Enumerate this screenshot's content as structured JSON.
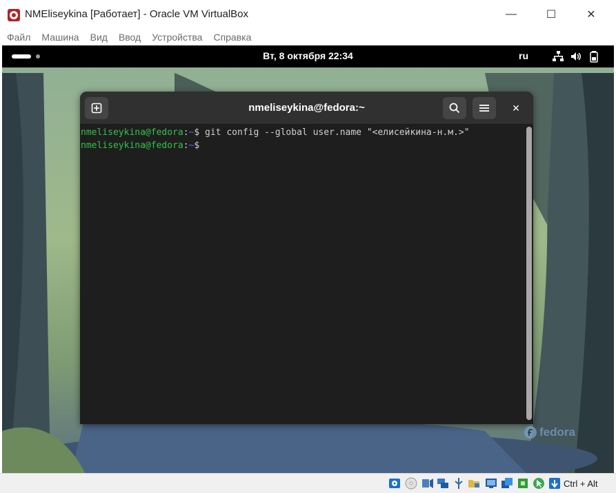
{
  "window": {
    "title": "NMEliseykina [Работает] - Oracle VM VirtualBox",
    "controls": {
      "minimize": "—",
      "maximize": "☐",
      "close": "✕"
    }
  },
  "menubar": {
    "items": [
      "Файл",
      "Машина",
      "Вид",
      "Ввод",
      "Устройства",
      "Справка"
    ]
  },
  "guest": {
    "topbar": {
      "clock": "Вт, 8 октября  22:34",
      "keyboard_layout": "ru",
      "tray_icons": [
        "network-icon",
        "volume-icon",
        "battery-icon"
      ]
    },
    "terminal": {
      "title": "nmeliseykina@fedora:~",
      "header_buttons": [
        "new-tab-icon",
        "search-icon",
        "menu-icon"
      ],
      "close_label": "✕",
      "lines": [
        {
          "user": "nmeliseykina@fedora",
          "sep": ":",
          "path": "~",
          "prompt": "$",
          "command": " git config --global user.name \"<елисейкина-н.м.>\""
        },
        {
          "user": "nmeliseykina@fedora",
          "sep": ":",
          "path": "~",
          "prompt": "$",
          "command": ""
        }
      ]
    },
    "watermark": "fedora"
  },
  "statusbar": {
    "icons": [
      "hard-disk-icon",
      "optical-disk-icon",
      "audio-icon",
      "network-adapter-icon",
      "usb-icon",
      "shared-folders-icon",
      "display-icon",
      "video-capture-icon",
      "cpu-icon",
      "mouse-integration-icon",
      "host-key-arrow-icon"
    ],
    "host_key": "Ctrl + Alt"
  },
  "colors": {
    "prompt_user": "#33c24a",
    "prompt_path": "#3b78ff",
    "terminal_bg": "#1e1e1e",
    "header_bg": "#303030"
  }
}
